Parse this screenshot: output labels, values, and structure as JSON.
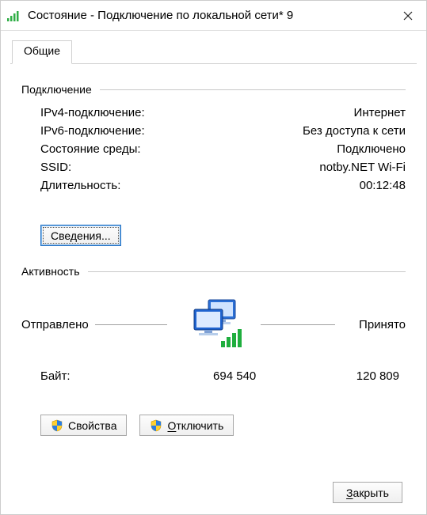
{
  "window": {
    "title": "Состояние - Подключение по локальной сети* 9"
  },
  "tabs": {
    "general": "Общие"
  },
  "connection": {
    "section": "Подключение",
    "ipv4_label": "IPv4-подключение:",
    "ipv4_value": "Интернет",
    "ipv6_label": "IPv6-подключение:",
    "ipv6_value": "Без доступа к сети",
    "media_label": "Состояние среды:",
    "media_value": "Подключено",
    "ssid_label": "SSID:",
    "ssid_value": "notby.NET Wi-Fi",
    "duration_label": "Длительность:",
    "duration_value": "00:12:48"
  },
  "buttons": {
    "details": "Сведения...",
    "properties": "Свойства",
    "disable_prefix": "О",
    "disable_rest": "тключить",
    "close_prefix": "З",
    "close_rest": "акрыть"
  },
  "activity": {
    "section": "Активность",
    "sent": "Отправлено",
    "received": "Принято",
    "bytes_label": "Байт:",
    "bytes_sent": "694 540",
    "bytes_received": "120 809"
  }
}
